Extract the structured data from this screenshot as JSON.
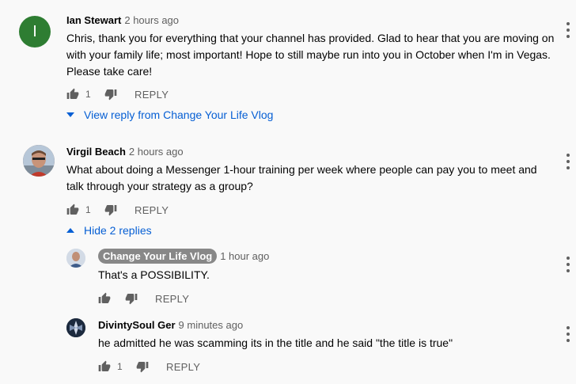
{
  "comments": [
    {
      "author": "Ian Stewart",
      "time": "2 hours ago",
      "avatar_letter": "I",
      "avatar_color": "#2e7d32",
      "text": "Chris, thank you for everything that your channel has provided.  Glad to hear that you are moving on with your family life; most important!  Hope to still maybe run into you in October when I'm in Vegas.  Please take care!",
      "likes": "1",
      "reply_label": "REPLY",
      "toggle_label": "View reply from Change Your Life Vlog"
    },
    {
      "author": "Virgil Beach",
      "time": "2 hours ago",
      "text": "What about doing a Messenger 1-hour training per week where people can pay you to meet and talk through your strategy as a group?",
      "likes": "1",
      "reply_label": "REPLY",
      "toggle_label": "Hide 2 replies",
      "replies": [
        {
          "author": "Change Your Life Vlog",
          "time": "1 hour ago",
          "text": "That's a POSSIBILITY.",
          "likes": "",
          "reply_label": "REPLY"
        },
        {
          "author": "DivintySoul Ger",
          "time": "9 minutes ago",
          "text": "he admitted he was scamming its in the title and he said \"the title is true\"",
          "likes": "1",
          "reply_label": "REPLY"
        }
      ]
    }
  ],
  "colors": {
    "link": "#065fd4",
    "secondary_text": "#606060",
    "background": "#f9f9f9"
  }
}
